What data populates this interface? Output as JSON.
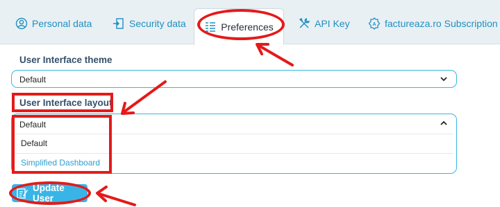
{
  "tabs": [
    {
      "label": "Personal data",
      "icon": "user-circle-icon"
    },
    {
      "label": "Security data",
      "icon": "lock-exit-icon"
    },
    {
      "label": "Preferences",
      "icon": "list-settings-icon",
      "active": true
    },
    {
      "label": "API Key",
      "icon": "tools-icon"
    },
    {
      "label": "factureaza.ro Subscription",
      "icon": "badge-icon"
    }
  ],
  "form": {
    "theme_label": "User Interface theme",
    "theme_value": "Default",
    "layout_label": "User Interface layout",
    "layout_value": "Default",
    "layout_options": [
      "Default",
      "Simplified Dashboard"
    ],
    "update_button": "Update User"
  },
  "colors": {
    "accent": "#38b5e6",
    "tab_text": "#1f8fc0",
    "annotation": "#e41a1a"
  }
}
